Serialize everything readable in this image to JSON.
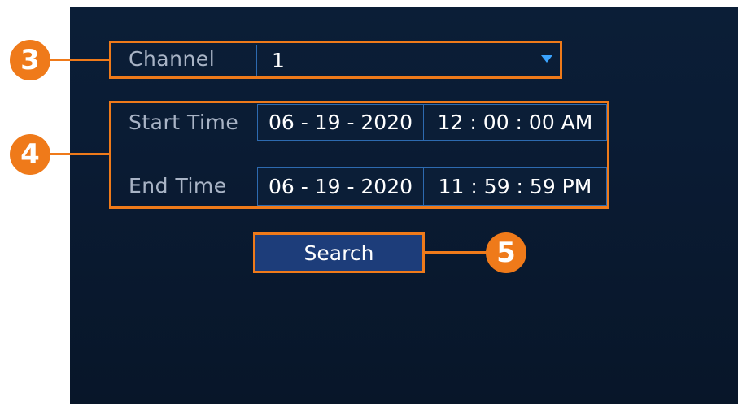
{
  "form": {
    "channel": {
      "label": "Channel",
      "value": "1"
    },
    "start_time": {
      "label": "Start Time",
      "date": "06 - 19 - 2020",
      "time": "12 : 00 : 00 AM"
    },
    "end_time": {
      "label": "End Time",
      "date": "06 - 19 - 2020",
      "time": "11 : 59 : 59 PM"
    },
    "search_label": "Search"
  },
  "callouts": {
    "channel": "3",
    "time_range": "4",
    "search": "5"
  },
  "colors": {
    "accent": "#ef7a1a",
    "panel": "#0b1e37",
    "field_border": "#2d6ab0",
    "button": "#1d3d7a"
  }
}
